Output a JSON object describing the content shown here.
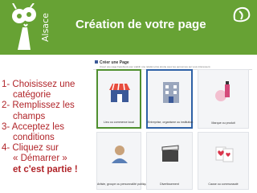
{
  "header": {
    "brand": "Alsace",
    "title": "Création de votre page"
  },
  "instructions": {
    "steps": [
      "1- Choisissez une",
      "catégorie",
      "2- Remplissez les",
      "champs",
      "3- Acceptez les",
      "conditions",
      "4- Cliquez sur",
      "« Démarrer »",
      "et c'est partie !"
    ]
  },
  "facebook": {
    "title": "Créer une Page",
    "subtitle": "Créez une page Facebook pour établir une relation plus étroite avec les personnes qui vous intéressent.",
    "categories": [
      "Lieu ou commerce local",
      "Entreprise, organisme ou institution",
      "Marque ou produit",
      "Artiste, groupe ou personnalité publique",
      "Divertissement",
      "Cause ou communauté"
    ]
  },
  "colors": {
    "header_green": "#67a234",
    "text_red": "#b12429",
    "selection_green": "#4f8f2f",
    "selection_blue": "#2f62a6"
  }
}
